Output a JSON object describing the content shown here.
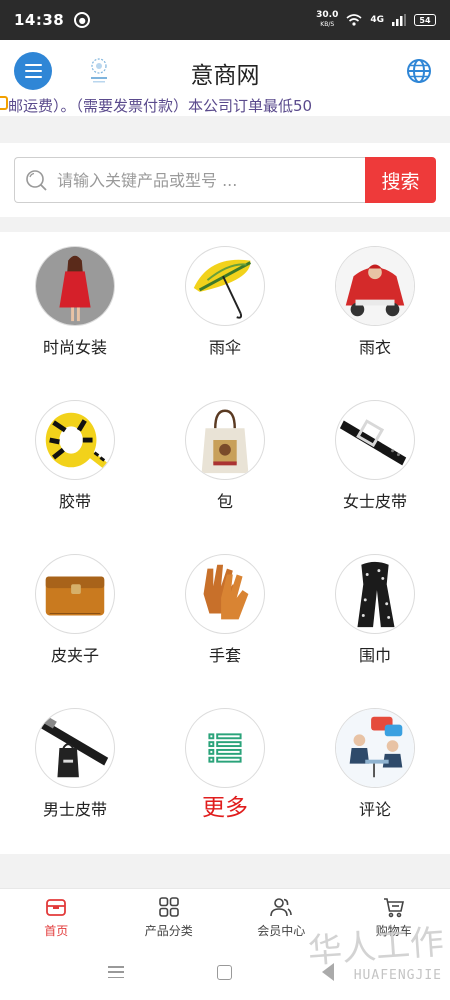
{
  "status_bar": {
    "time": "14:38",
    "net_speed": "30.0",
    "net_speed_unit": "KB/S",
    "network": "4G",
    "battery": "54"
  },
  "header": {
    "title": "意商网",
    "logo_icon": "brand-logo",
    "menu_icon": "hamburger-icon",
    "language_icon": "globe-icon"
  },
  "announcement": {
    "text": "邮运费）。（需要发票付款）本公司订单最低50"
  },
  "search": {
    "placeholder": "请输入关键产品或型号 ...",
    "button_label": "搜索"
  },
  "categories": [
    {
      "label": "时尚女装",
      "icon": "red-coat"
    },
    {
      "label": "雨伞",
      "icon": "umbrella"
    },
    {
      "label": "雨衣",
      "icon": "raincoat"
    },
    {
      "label": "胶带",
      "icon": "tape"
    },
    {
      "label": "包",
      "icon": "tote-bag"
    },
    {
      "label": "女士皮带",
      "icon": "womens-belt"
    },
    {
      "label": "皮夹子",
      "icon": "wallet"
    },
    {
      "label": "手套",
      "icon": "gloves"
    },
    {
      "label": "围巾",
      "icon": "scarf"
    },
    {
      "label": "男士皮带",
      "icon": "mens-belt"
    },
    {
      "label": "更多",
      "icon": "list"
    },
    {
      "label": "评论",
      "icon": "comments"
    }
  ],
  "bottom_nav": [
    {
      "label": "首页",
      "icon": "home-icon",
      "active": true
    },
    {
      "label": "产品分类",
      "icon": "grid-icon",
      "active": false
    },
    {
      "label": "会员中心",
      "icon": "members-icon",
      "active": false
    },
    {
      "label": "购物车",
      "icon": "cart-icon",
      "active": false
    }
  ],
  "watermark": {
    "text": "华人工作",
    "sub": "HUAFENGJIE"
  },
  "colors": {
    "accent_blue": "#2f86d6",
    "search_red": "#ee3a3a",
    "more_red": "#e01e1e",
    "active_nav": "#e23a3a"
  }
}
